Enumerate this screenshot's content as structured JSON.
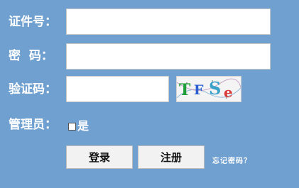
{
  "form": {
    "id_label": "证件号：",
    "password_label": "密  码：",
    "captcha_label": "验证码：",
    "admin_label": "管理员：",
    "id_value": "",
    "password_value": "",
    "captcha_value": ""
  },
  "captcha_image": {
    "chars": [
      "T",
      "F",
      "S",
      "e"
    ],
    "colors": [
      "#1f9e3a",
      "#2b5fd0",
      "#3aa0c8",
      "#d93b3b"
    ]
  },
  "admin_checkbox": {
    "label": "是",
    "checked": false
  },
  "buttons": {
    "login": "登录",
    "register": "注册"
  },
  "links": {
    "forgot_password": "忘记密码？"
  },
  "colors": {
    "background": "#6fa0cf"
  }
}
